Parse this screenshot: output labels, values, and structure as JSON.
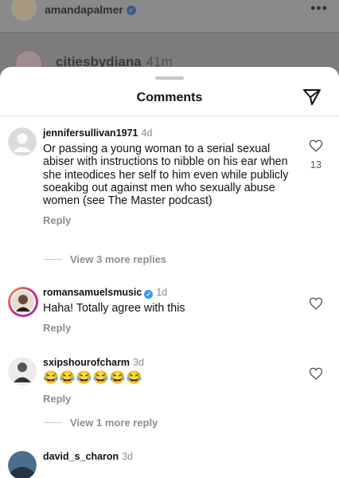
{
  "background": {
    "post_user": "amandapalmer",
    "more": "•••",
    "comment_user": "citiesbydiana",
    "comment_time": "41m"
  },
  "header": {
    "title": "Comments"
  },
  "comments": [
    {
      "username": "jennifersullivan1971",
      "time": "4d",
      "text": "Or passing a young woman to a serial sexual abiser with instructions to nibble on his ear when she inteodices her self to him even while publicly soeakibg out against men who sexually abuse women (see The Master podcast)",
      "reply_label": "Reply",
      "likes": "13",
      "more_replies": "View 3 more replies"
    },
    {
      "username": "romansamuelsmusic",
      "verified": true,
      "time": "1d",
      "text": "Haha! Totally agree with this",
      "reply_label": "Reply"
    },
    {
      "username": "sxipshourofcharm",
      "time": "3d",
      "text": "😂😂😂😂😂😂",
      "reply_label": "Reply",
      "more_replies": "View 1 more reply"
    },
    {
      "username": "david_s_charon",
      "time": "3d"
    }
  ],
  "colors": {
    "accent_blue": "#3897f0",
    "muted_text": "#8e8e8e",
    "story_ring": "#d62976"
  }
}
